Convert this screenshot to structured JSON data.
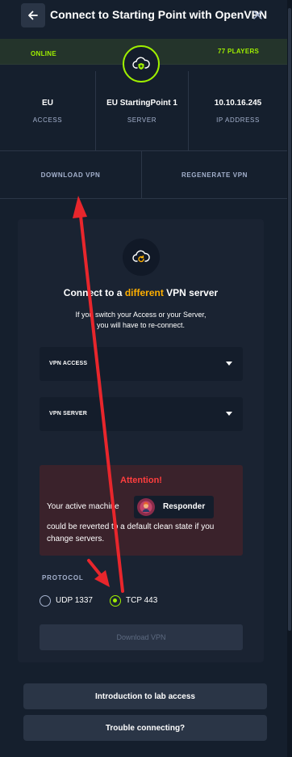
{
  "header": {
    "title": "Connect to Starting Point with OpenVPN",
    "back_icon": "arrow-left-icon",
    "close_icon": "close-icon"
  },
  "status": {
    "online_label": "ONLINE",
    "players_label": "77 PLAYERS",
    "badge_icon": "cloud-shield-icon"
  },
  "info": [
    {
      "value": "EU",
      "label": "ACCESS"
    },
    {
      "value": "EU StartingPoint 1",
      "label": "SERVER"
    },
    {
      "value": "10.10.16.245",
      "label": "IP ADDRESS"
    }
  ],
  "actions": {
    "download_vpn": "DOWNLOAD VPN",
    "regenerate_vpn": "REGENERATE VPN"
  },
  "card": {
    "icon": "cloud-refresh-icon",
    "heading_prefix": "Connect to a",
    "heading_accent": "different",
    "heading_suffix": "VPN server",
    "description_line1": "If you switch your Access or your Server,",
    "description_line2": "you will have to re-connect.",
    "vpn_access_label": "VPN ACCESS",
    "vpn_server_label": "VPN SERVER"
  },
  "attention": {
    "title": "Attention!",
    "text_before": "Your active machine",
    "machine_name": "Responder",
    "text_after": "could be reverted to a default clean state if you change servers."
  },
  "protocol": {
    "label": "PROTOCOL",
    "options": [
      "UDP 1337",
      "TCP 443"
    ],
    "selected": "TCP 443"
  },
  "download_button": "Download VPN",
  "footer": {
    "intro_button": "Introduction to lab access",
    "trouble_button": "Trouble connecting?"
  },
  "colors": {
    "accent_green": "#9fef00",
    "accent_orange": "#ffaf00",
    "alert_red": "#ff3e3e",
    "annotation_red": "#e8262c"
  }
}
